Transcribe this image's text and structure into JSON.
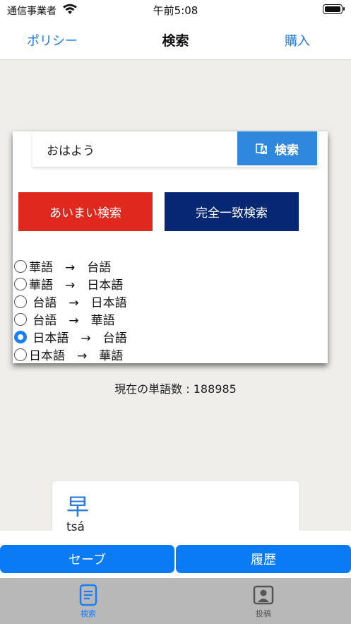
{
  "status": {
    "carrier": "通信事業者",
    "time": "午前5:08"
  },
  "nav": {
    "left": "ポリシー",
    "title": "検索",
    "right": "購入"
  },
  "search": {
    "value": "おはよう",
    "button": "検索"
  },
  "buttons": {
    "fuzzy": "あいまい検索",
    "exact": "完全一致検索"
  },
  "options": [
    {
      "label": "華語　→　台語",
      "selected": false
    },
    {
      "label": "華語　→　日本語",
      "selected": false
    },
    {
      "label": " 台語　→　日本語",
      "selected": false
    },
    {
      "label": " 台語　→　華語",
      "selected": false
    },
    {
      "label": " 日本語　→　台語",
      "selected": true
    },
    {
      "label": "日本語　→　華語",
      "selected": false
    }
  ],
  "word_count": "現在の単語数 : 188985",
  "card": {
    "character": "早",
    "reading": "tsá"
  },
  "actions": {
    "save": "セーブ",
    "history": "履歴"
  },
  "tabs": {
    "search": "検索",
    "post": "投稿"
  },
  "colors": {
    "accent": "#1e7be3",
    "fuzzy": "#df291e",
    "exact": "#062774",
    "action": "#0a7bf4"
  }
}
